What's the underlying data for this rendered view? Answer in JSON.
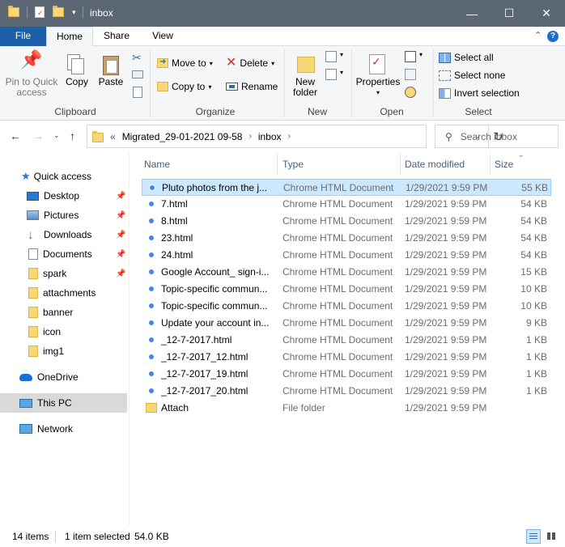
{
  "window": {
    "title": "inbox",
    "minimize_glyph": "—",
    "maximize_glyph": "☐",
    "close_glyph": "✕"
  },
  "ribbon_tabs": {
    "file": "File",
    "home": "Home",
    "share": "Share",
    "view": "View",
    "help": "?"
  },
  "ribbon": {
    "clipboard": {
      "label": "Clipboard",
      "pin_to_quick_access": "Pin to Quick access",
      "copy": "Copy",
      "paste": "Paste"
    },
    "organize": {
      "label": "Organize",
      "move_to": "Move to",
      "copy_to": "Copy to",
      "delete": "Delete",
      "rename": "Rename"
    },
    "new": {
      "label": "New",
      "new_folder": "New folder"
    },
    "open": {
      "label": "Open",
      "properties": "Properties"
    },
    "select": {
      "label": "Select",
      "select_all": "Select all",
      "select_none": "Select none",
      "invert_selection": "Invert selection"
    }
  },
  "address": {
    "overflow": "«",
    "segments": [
      "Migrated_29-01-2021 09-58",
      "inbox"
    ],
    "search_placeholder": "Search inbox"
  },
  "nav_pane": {
    "items": [
      {
        "label": "Quick access",
        "icon": "star-icon",
        "pinned": false
      },
      {
        "label": "Desktop",
        "icon": "desktop-icon",
        "pinned": true
      },
      {
        "label": "Pictures",
        "icon": "pictures-icon",
        "pinned": true
      },
      {
        "label": "Downloads",
        "icon": "downloads-icon",
        "pinned": true
      },
      {
        "label": "Documents",
        "icon": "documents-icon",
        "pinned": true
      },
      {
        "label": "spark",
        "icon": "folder-icon",
        "pinned": true
      },
      {
        "label": "attachments",
        "icon": "folder-icon",
        "pinned": false
      },
      {
        "label": "banner",
        "icon": "folder-icon",
        "pinned": false
      },
      {
        "label": "icon",
        "icon": "folder-icon",
        "pinned": false
      },
      {
        "label": "img1",
        "icon": "folder-icon",
        "pinned": false
      },
      {
        "label": "OneDrive",
        "icon": "cloud-icon",
        "pinned": false
      },
      {
        "label": "This PC",
        "icon": "computer-icon",
        "pinned": false,
        "selected": true
      },
      {
        "label": "Network",
        "icon": "network-icon",
        "pinned": false
      }
    ]
  },
  "columns": {
    "name": "Name",
    "type": "Type",
    "date_modified": "Date modified",
    "size": "Size"
  },
  "files": [
    {
      "name": "Pluto photos from the j...",
      "type": "Chrome HTML Document",
      "date": "1/29/2021 9:59 PM",
      "size": "55 KB",
      "icon": "chrome-icon",
      "selected": true
    },
    {
      "name": "7.html",
      "type": "Chrome HTML Document",
      "date": "1/29/2021 9:59 PM",
      "size": "54 KB",
      "icon": "chrome-icon"
    },
    {
      "name": "8.html",
      "type": "Chrome HTML Document",
      "date": "1/29/2021 9:59 PM",
      "size": "54 KB",
      "icon": "chrome-icon"
    },
    {
      "name": "23.html",
      "type": "Chrome HTML Document",
      "date": "1/29/2021 9:59 PM",
      "size": "54 KB",
      "icon": "chrome-icon"
    },
    {
      "name": "24.html",
      "type": "Chrome HTML Document",
      "date": "1/29/2021 9:59 PM",
      "size": "54 KB",
      "icon": "chrome-icon"
    },
    {
      "name": "Google Account_ sign-i...",
      "type": "Chrome HTML Document",
      "date": "1/29/2021 9:59 PM",
      "size": "15 KB",
      "icon": "chrome-icon"
    },
    {
      "name": "Topic-specific commun...",
      "type": "Chrome HTML Document",
      "date": "1/29/2021 9:59 PM",
      "size": "10 KB",
      "icon": "chrome-icon"
    },
    {
      "name": "Topic-specific commun...",
      "type": "Chrome HTML Document",
      "date": "1/29/2021 9:59 PM",
      "size": "10 KB",
      "icon": "chrome-icon"
    },
    {
      "name": "Update your account in...",
      "type": "Chrome HTML Document",
      "date": "1/29/2021 9:59 PM",
      "size": "9 KB",
      "icon": "chrome-icon"
    },
    {
      "name": "_12-7-2017.html",
      "type": "Chrome HTML Document",
      "date": "1/29/2021 9:59 PM",
      "size": "1 KB",
      "icon": "chrome-icon"
    },
    {
      "name": "_12-7-2017_12.html",
      "type": "Chrome HTML Document",
      "date": "1/29/2021 9:59 PM",
      "size": "1 KB",
      "icon": "chrome-icon"
    },
    {
      "name": "_12-7-2017_19.html",
      "type": "Chrome HTML Document",
      "date": "1/29/2021 9:59 PM",
      "size": "1 KB",
      "icon": "chrome-icon"
    },
    {
      "name": "_12-7-2017_20.html",
      "type": "Chrome HTML Document",
      "date": "1/29/2021 9:59 PM",
      "size": "1 KB",
      "icon": "chrome-icon"
    },
    {
      "name": "Attach",
      "type": "File folder",
      "date": "1/29/2021 9:59 PM",
      "size": "",
      "icon": "folder-icon"
    }
  ],
  "status": {
    "item_count": "14 items",
    "selection": "1 item selected",
    "selection_size": "54.0 KB"
  },
  "colors": {
    "titlebar": "#5b6774",
    "file_tab": "#1c5fa8",
    "selection_bg": "#cce8ff",
    "selection_border": "#99d1ff",
    "nav_selected": "#d9d9d9"
  }
}
